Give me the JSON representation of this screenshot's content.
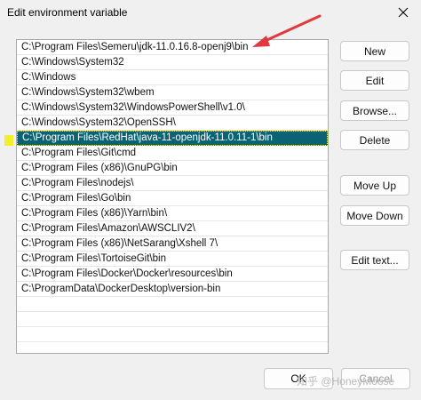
{
  "window": {
    "title": "Edit environment variable"
  },
  "paths": [
    "C:\\Program Files\\Semeru\\jdk-11.0.16.8-openj9\\bin",
    "C:\\Windows\\System32",
    "C:\\Windows",
    "C:\\Windows\\System32\\wbem",
    "C:\\Windows\\System32\\WindowsPowerShell\\v1.0\\",
    "C:\\Windows\\System32\\OpenSSH\\",
    "C:\\Program Files\\RedHat\\java-11-openjdk-11.0.11-1\\bin",
    "C:\\Program Files\\Git\\cmd",
    "C:\\Program Files (x86)\\GnuPG\\bin",
    "C:\\Program Files\\nodejs\\",
    "C:\\Program Files\\Go\\bin",
    "C:\\Program Files (x86)\\Yarn\\bin\\",
    "C:\\Program Files\\Amazon\\AWSCLIV2\\",
    "C:\\Program Files (x86)\\NetSarang\\Xshell 7\\",
    "C:\\Program Files\\TortoiseGit\\bin",
    "C:\\Program Files\\Docker\\Docker\\resources\\bin",
    "C:\\ProgramData\\DockerDesktop\\version-bin"
  ],
  "selected_index": 6,
  "total_rows": 21,
  "buttons": {
    "new": "New",
    "edit": "Edit",
    "browse": "Browse...",
    "delete": "Delete",
    "move_up": "Move Up",
    "move_down": "Move Down",
    "edit_text": "Edit text...",
    "ok": "OK",
    "cancel": "Cancel"
  },
  "watermark": "知乎 @HoneyMoose",
  "colors": {
    "selection_bg": "#0a6375",
    "selection_border": "#ffff00",
    "annotation_arrow": "#e0393e",
    "marker": "#f2ef2e"
  },
  "icons": {
    "close": "close-icon",
    "arrow": "annotation-arrow"
  }
}
